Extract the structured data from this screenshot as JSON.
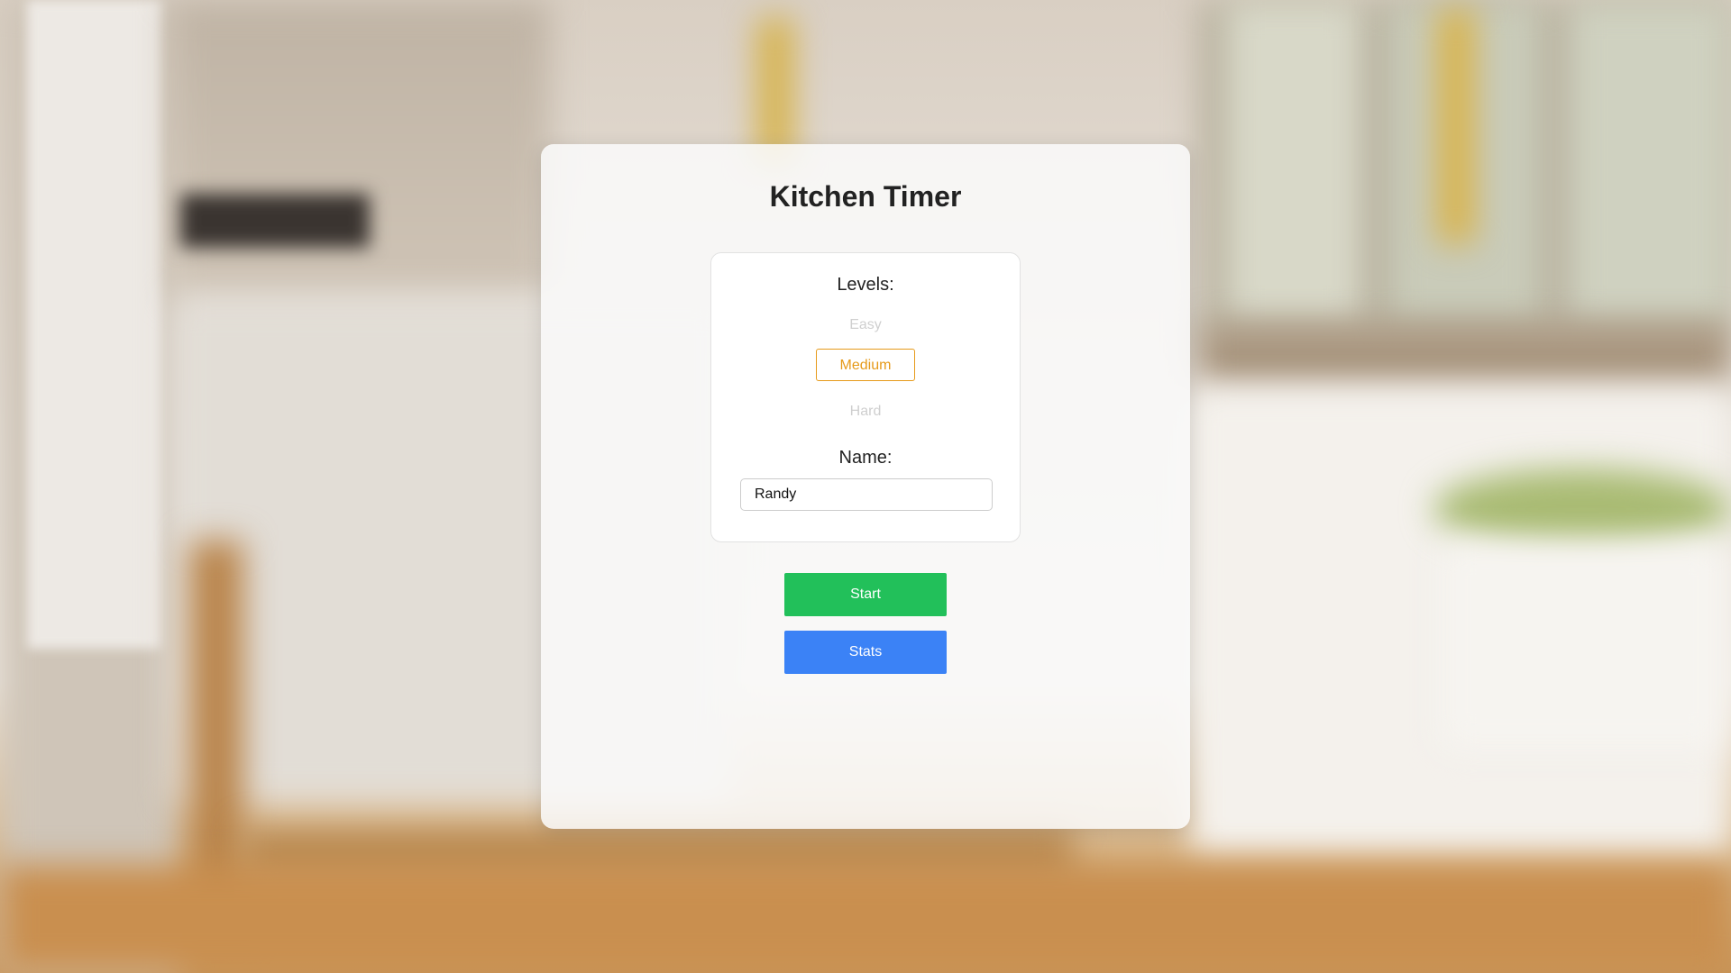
{
  "app": {
    "title": "Kitchen Timer"
  },
  "levels": {
    "label": "Levels:",
    "options": [
      {
        "label": "Easy",
        "selected": false
      },
      {
        "label": "Medium",
        "selected": true
      },
      {
        "label": "Hard",
        "selected": false
      }
    ]
  },
  "name": {
    "label": "Name:",
    "value": "Randy",
    "placeholder": ""
  },
  "actions": {
    "start_label": "Start",
    "stats_label": "Stats"
  },
  "colors": {
    "selected_accent": "#e69a1a",
    "start_button": "#22c05a",
    "stats_button": "#3b82f6"
  }
}
